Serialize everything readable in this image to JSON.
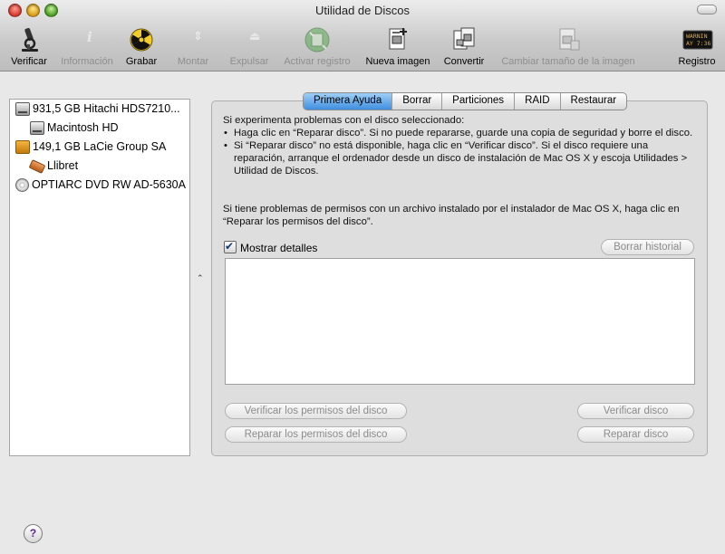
{
  "window": {
    "title": "Utilidad de Discos"
  },
  "toolbar": {
    "items": [
      {
        "id": "verificar",
        "label": "Verificar",
        "icon": "microscope-icon",
        "enabled": true
      },
      {
        "id": "informacion",
        "label": "Información",
        "icon": "info-icon",
        "enabled": false
      },
      {
        "id": "grabar",
        "label": "Grabar",
        "icon": "burn-icon",
        "enabled": true
      },
      {
        "id": "montar",
        "label": "Montar",
        "icon": "mount-icon",
        "enabled": false
      },
      {
        "id": "expulsar",
        "label": "Expulsar",
        "icon": "eject-icon",
        "enabled": false
      },
      {
        "id": "activar_registro",
        "label": "Activar registro",
        "icon": "journal-icon",
        "enabled": false
      },
      {
        "id": "nueva_imagen",
        "label": "Nueva imagen",
        "icon": "new-image-icon",
        "enabled": true
      },
      {
        "id": "convertir",
        "label": "Convertir",
        "icon": "convert-icon",
        "enabled": true
      },
      {
        "id": "cambiar_tamano",
        "label": "Cambiar tamaño de la imagen",
        "icon": "resize-image-icon",
        "enabled": false
      },
      {
        "id": "registro",
        "label": "Registro",
        "icon": "log-icon",
        "enabled": true
      }
    ],
    "log_icon_text": [
      "WARNIN",
      "AY 7:36"
    ]
  },
  "disks": [
    {
      "label": "931,5 GB Hitachi HDS7210...",
      "icon": "hard-disk-icon"
    },
    {
      "label": "Macintosh HD",
      "icon": "volume-icon"
    },
    {
      "label": "149,1 GB LaCie Group SA",
      "icon": "external-disk-icon"
    },
    {
      "label": "Llibret",
      "icon": "volume-icon"
    },
    {
      "label": "OPTIARC DVD RW AD-5630A",
      "icon": "optical-disc-icon"
    }
  ],
  "tabs": [
    {
      "label": "Primera Ayuda",
      "active": true
    },
    {
      "label": "Borrar",
      "active": false
    },
    {
      "label": "Particiones",
      "active": false
    },
    {
      "label": "RAID",
      "active": false
    },
    {
      "label": "Restaurar",
      "active": false
    }
  ],
  "first_aid": {
    "intro": "Si experimenta problemas con el disco seleccionado:",
    "bullets": [
      "Haga clic en “Reparar disco”. Si no puede repararse, guarde una copia de seguridad y borre el disco.",
      "Si “Reparar disco” no está disponible, haga clic en “Verificar disco”. Si el disco requiere una reparación, arranque el ordenador desde un disco de instalación de Mac OS X y escoja Utilidades > Utilidad de Discos."
    ],
    "permissions_text": "Si tiene problemas de permisos con un archivo instalado por el instalador de Mac OS X, haga clic en “Reparar los permisos del disco”.",
    "show_details_label": "Mostrar detalles",
    "show_details_checked": true,
    "clear_history_label": "Borrar historial",
    "verify_permissions_label": "Verificar los permisos del disco",
    "repair_permissions_label": "Reparar los permisos del disco",
    "verify_disk_label": "Verificar disco",
    "repair_disk_label": "Reparar disco"
  },
  "help_label": "?"
}
